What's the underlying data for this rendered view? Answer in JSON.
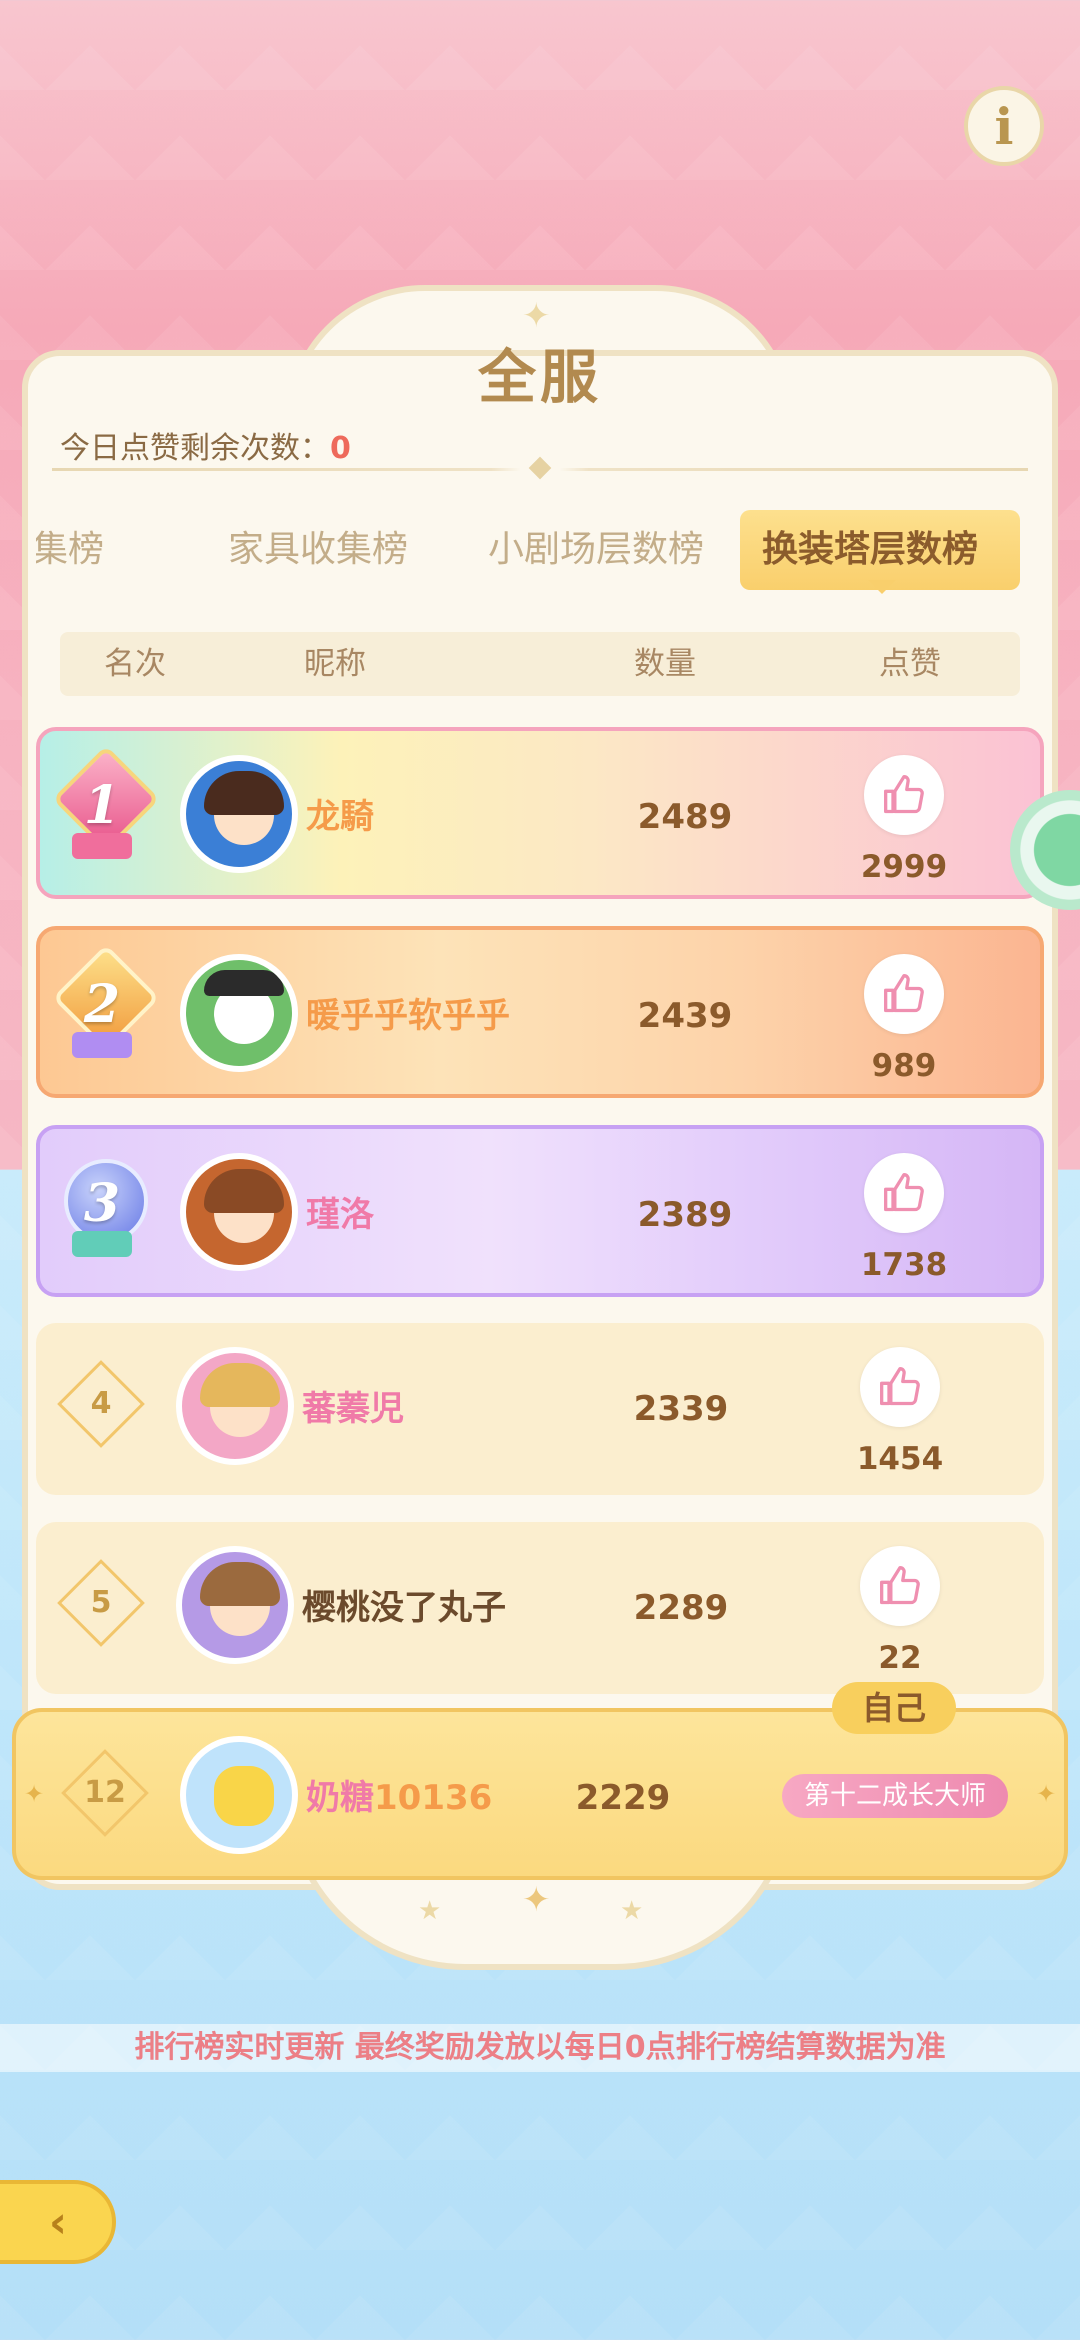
{
  "header": {
    "title": "全服",
    "likes_remaining_label": "今日点赞剩余次数：",
    "likes_remaining_value": "0"
  },
  "tabs": [
    {
      "label": "收集榜",
      "active": false
    },
    {
      "label": "家具收集榜",
      "active": false
    },
    {
      "label": "小剧场层数榜",
      "active": false
    },
    {
      "label": "换装塔层数榜",
      "active": true
    }
  ],
  "columns": {
    "rank": "名次",
    "nickname": "昵称",
    "count": "数量",
    "likes": "点赞"
  },
  "rows": [
    {
      "rank": "1",
      "nickname": "龙騎",
      "count": "2489",
      "likes": "2999"
    },
    {
      "rank": "2",
      "nickname": "暖乎乎软乎乎",
      "count": "2439",
      "likes": "989"
    },
    {
      "rank": "3",
      "nickname": "瑾洛",
      "count": "2389",
      "likes": "1738"
    },
    {
      "rank": "4",
      "nickname": "蕃蓁児",
      "count": "2339",
      "likes": "1454"
    },
    {
      "rank": "5",
      "nickname": "樱桃没了丸子",
      "count": "2289",
      "likes": "22"
    }
  ],
  "self_row": {
    "rank": "12",
    "nickname_prefix": "奶糖",
    "nickname_suffix": "10136",
    "count": "2229",
    "tag": "自己",
    "title": "第十二成长大师"
  },
  "footer": {
    "notice": "排行榜实时更新 最终奖励发放以每日0点排行榜结算数据为准"
  },
  "colors": {
    "accent": "#f9cf6c",
    "like_icon": "#ef8fb0",
    "name_pink": "#f07aa8",
    "name_orange": "#f59b4a"
  },
  "icons": {
    "info": "info-icon",
    "like": "thumbs-up-icon",
    "back": "back-arrow-icon",
    "chat": "chat-bubble-icon"
  }
}
